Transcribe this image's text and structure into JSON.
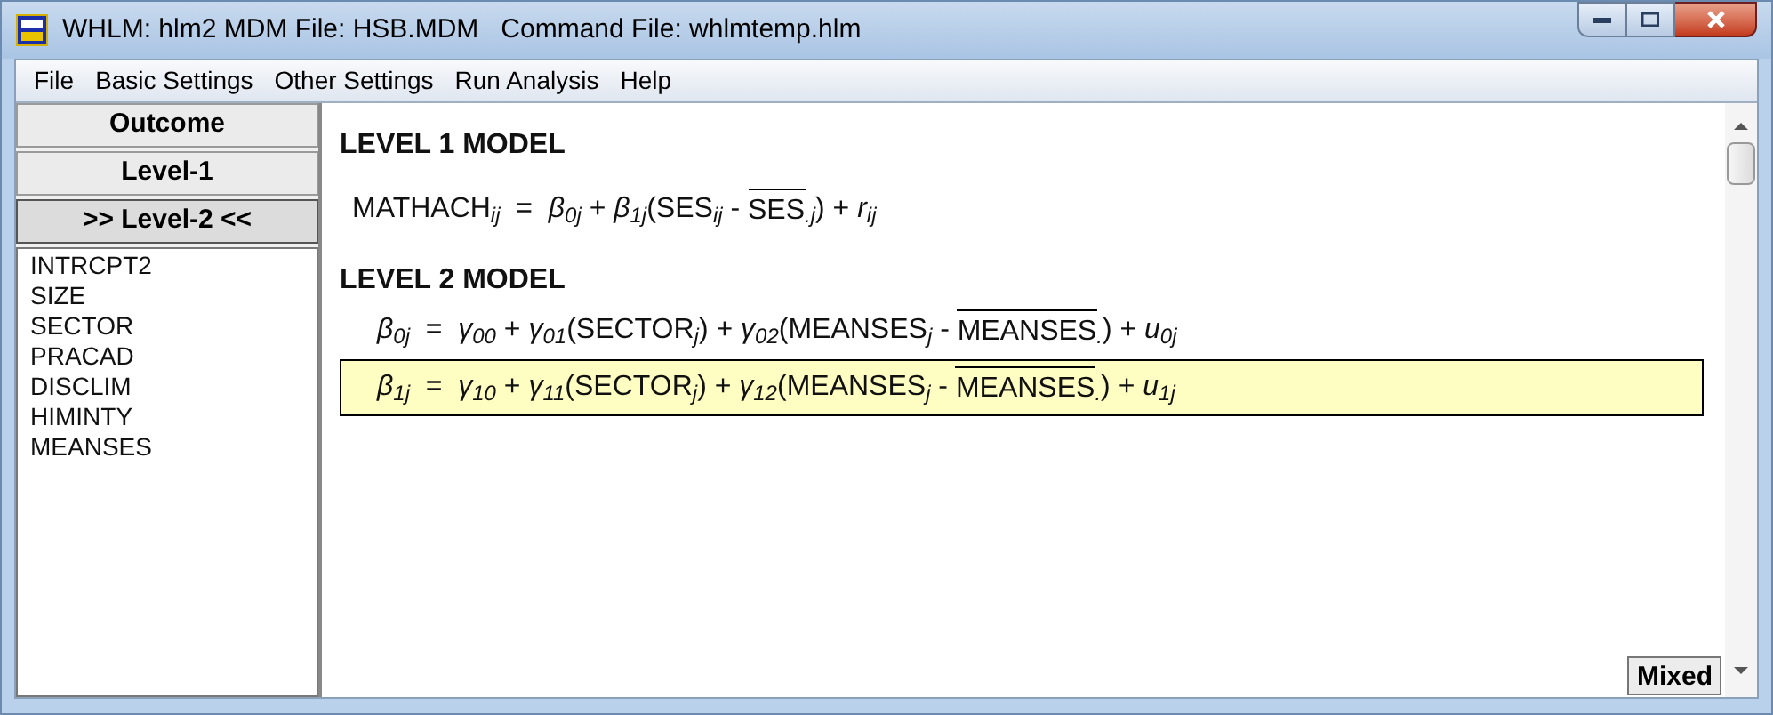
{
  "window": {
    "title": "WHLM: hlm2 MDM File: HSB.MDM   Command File: whlmtemp.hlm"
  },
  "menu": [
    "File",
    "Basic Settings",
    "Other Settings",
    "Run Analysis",
    "Help"
  ],
  "tabs": [
    {
      "label": "Outcome",
      "selected": false
    },
    {
      "label": "Level-1",
      "selected": false
    },
    {
      "label": ">> Level-2 <<",
      "selected": true
    }
  ],
  "variables": [
    "INTRCPT2",
    "SIZE",
    "SECTOR",
    "PRACAD",
    "DISCLIM",
    "HIMINTY",
    "MEANSES"
  ],
  "sections": [
    {
      "heading": "LEVEL 1 MODEL",
      "equations": [
        {
          "selected": false,
          "parts": [
            {
              "kind": "plain",
              "text": "MATHACH$_{ij}$  =  *β*$_{0j}$ + *β*$_{1j}$(SES$_{ij}$ - "
            },
            {
              "kind": "bar",
              "text": "SES"
            },
            {
              "kind": "plain",
              "text": "$_{.j}$) + *r*$_{ij}$"
            }
          ]
        }
      ]
    },
    {
      "heading": "LEVEL 2 MODEL",
      "equations": [
        {
          "selected": false,
          "parts": [
            {
              "kind": "plain",
              "text": "*β*$_{0j}$  =  *γ*$_{00}$ + *γ*$_{01}$(SECTOR$_{j}$) + *γ*$_{02}$(MEANSES$_{j}$ - "
            },
            {
              "kind": "bar",
              "text": "MEANSES"
            },
            {
              "kind": "plain",
              "text": "$_{.}$) + *u*$_{0j}$"
            }
          ]
        },
        {
          "selected": true,
          "parts": [
            {
              "kind": "plain",
              "text": "*β*$_{1j}$  =  *γ*$_{10}$ + *γ*$_{11}$(SECTOR$_{j}$) + *γ*$_{12}$(MEANSES$_{j}$ - "
            },
            {
              "kind": "bar",
              "text": "MEANSES"
            },
            {
              "kind": "plain",
              "text": "$_{.}$) + *u*$_{1j}$"
            }
          ]
        }
      ]
    }
  ],
  "mixed_button": "Mixed"
}
